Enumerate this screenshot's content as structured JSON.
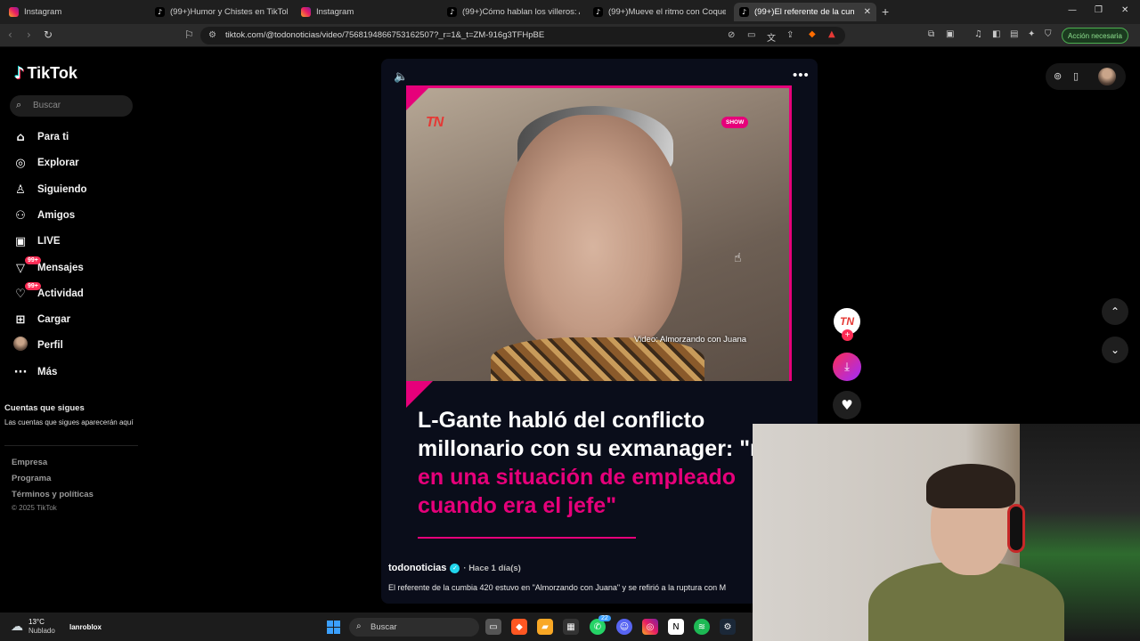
{
  "browser": {
    "tabs": [
      {
        "label": "Instagram",
        "icon": "instagram-icon"
      },
      {
        "label": "(99+)Humor y Chistes en TikTok | Tik",
        "icon": "tiktok-icon"
      },
      {
        "label": "Instagram",
        "icon": "instagram-icon"
      },
      {
        "label": "(99+)Cómo hablan los villeros: Actin",
        "icon": "tiktok-icon"
      },
      {
        "label": "(99+)Mueve el ritmo con Coqueta y",
        "icon": "tiktok-icon"
      },
      {
        "label": "(99+)El referente de la cumb",
        "icon": "tiktok-icon"
      }
    ],
    "url": "tiktok.com/@todonoticias/video/7568194866753162507?_r=1&_t=ZM-916g3TFHpBE",
    "action_button": "Acción necesaria"
  },
  "sidebar": {
    "brand": "TikTok",
    "search_placeholder": "Buscar",
    "items": [
      {
        "label": "Para ti",
        "icon": "home-icon"
      },
      {
        "label": "Explorar",
        "icon": "compass-icon"
      },
      {
        "label": "Siguiendo",
        "icon": "following-icon"
      },
      {
        "label": "Amigos",
        "icon": "friends-icon"
      },
      {
        "label": "LIVE",
        "icon": "live-icon"
      },
      {
        "label": "Mensajes",
        "icon": "messages-icon",
        "badge": "99+"
      },
      {
        "label": "Actividad",
        "icon": "activity-icon",
        "badge": "99+"
      },
      {
        "label": "Cargar",
        "icon": "upload-icon"
      },
      {
        "label": "Perfil",
        "icon": "profile-avatar"
      },
      {
        "label": "Más",
        "icon": "more-icon"
      }
    ],
    "following_heading": "Cuentas que sigues",
    "following_text": "Las cuentas que sigues aparecerán aquí",
    "footer": [
      "Empresa",
      "Programa",
      "Términos y políticas"
    ],
    "copyright": "© 2025 TikTok"
  },
  "video": {
    "channel_logo": "TN",
    "tag": "SHOW",
    "credit": "Video: Almorzando con Juana",
    "headline_white": "L-Gante habló del conflicto millonario con su exmanager: \"me",
    "headline_pink": "vi en una situación de empleado cuando era el jefe\"",
    "author": "todonoticias",
    "posted": "· Hace 1 día(s)",
    "description": "El referente de la cumbia 420 estuvo en \"Almorzando con Juana\" y se refirió a la ruptura con M"
  },
  "actions": {
    "avatar_text": "TN",
    "plus": "+"
  },
  "taskbar": {
    "temperature": "13°C",
    "condition": "Nublado",
    "user": "lanroblox",
    "search_placeholder": "Buscar",
    "whatsapp_badge": "22"
  },
  "colors": {
    "accent": "#e6007a",
    "tiktok_red": "#fe2c55"
  }
}
